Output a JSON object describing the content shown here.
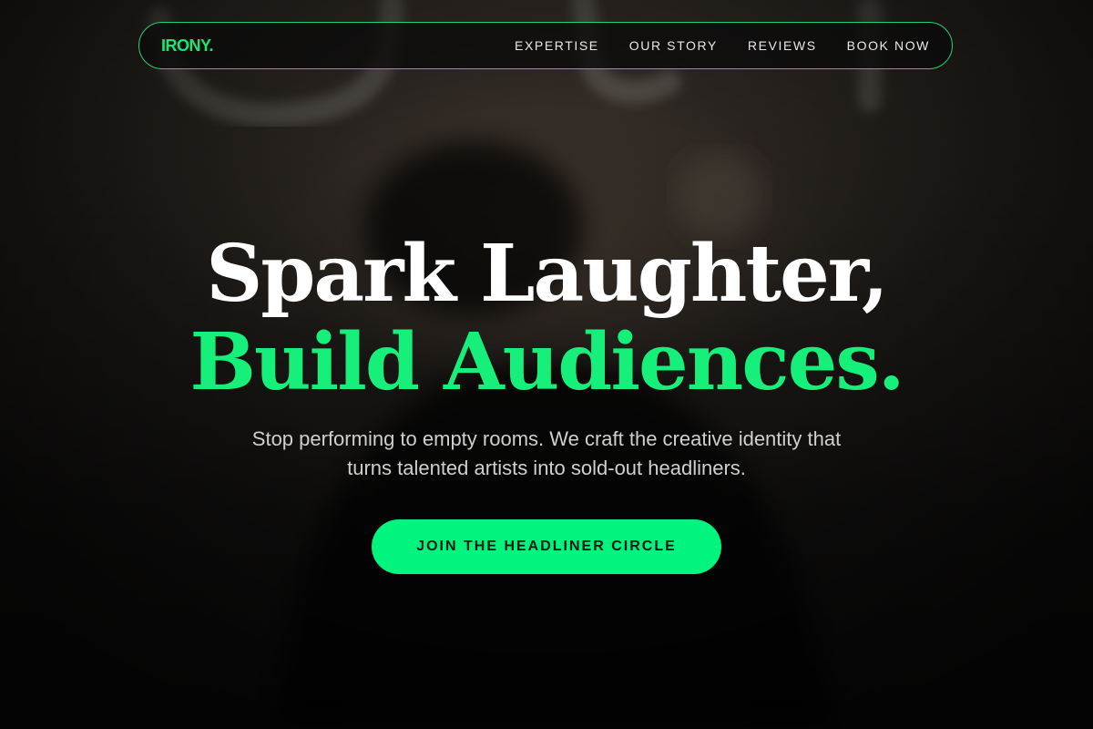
{
  "brand": {
    "logo": "IRONY.",
    "accent_color": "#00f47e"
  },
  "nav": {
    "items": [
      {
        "label": "EXPERTISE"
      },
      {
        "label": "OUR STORY"
      },
      {
        "label": "REVIEWS"
      },
      {
        "label": "BOOK NOW"
      }
    ]
  },
  "hero": {
    "headline_line1": "Spark Laughter,",
    "headline_line2": "Build Audiences.",
    "subtext": "Stop performing to empty rooms. We craft the creative identity that turns talented artists into sold-out headliners.",
    "cta_label": "JOIN THE HEADLINER CIRCLE"
  }
}
